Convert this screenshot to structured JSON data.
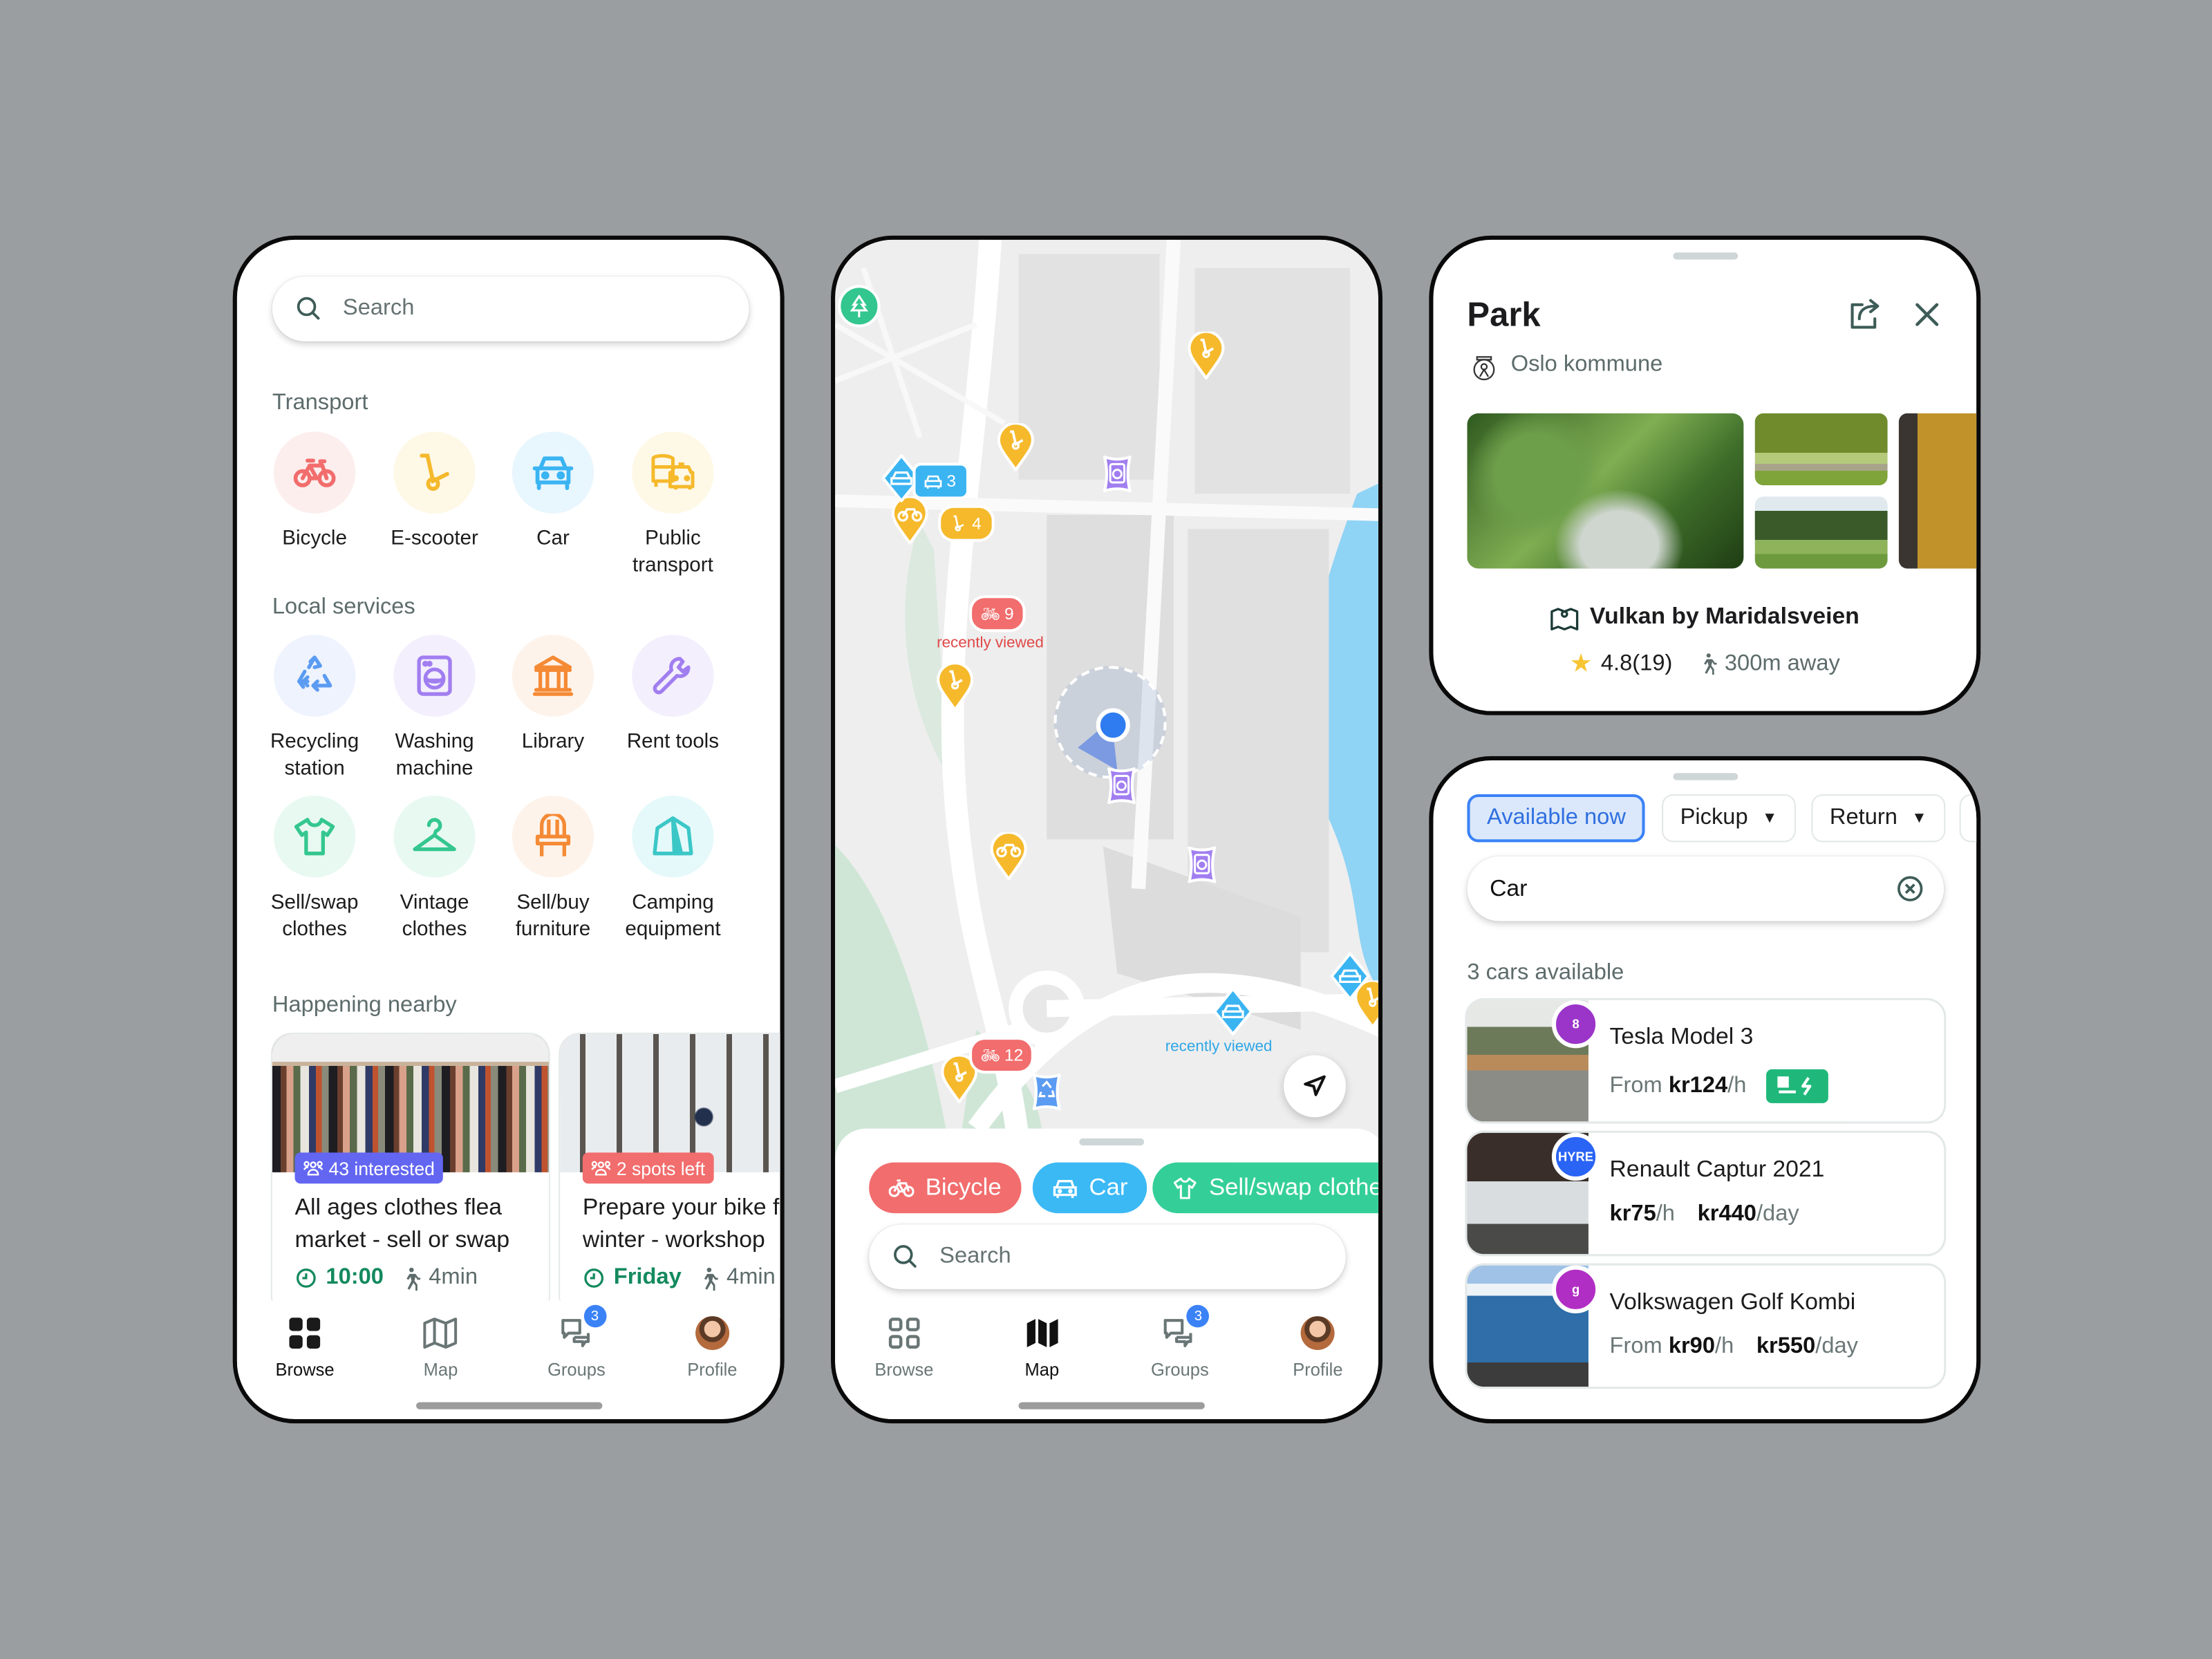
{
  "browse_screen": {
    "search_placeholder": "Search",
    "transport": {
      "title": "Transport",
      "items": [
        {
          "label": "Bicycle",
          "icon": "bicycle-icon",
          "color": "#f26d6d",
          "bg": "#fdeeee"
        },
        {
          "label": "E-scooter",
          "icon": "scooter-icon",
          "color": "#f5b92b",
          "bg": "#fef8e6"
        },
        {
          "label": "Car",
          "icon": "car-icon",
          "color": "#3bb4f2",
          "bg": "#e8f6fd"
        },
        {
          "label": "Public transport",
          "icon": "bus-taxi-icon",
          "color": "#f5b92b",
          "bg": "#fef8e6"
        }
      ]
    },
    "local_services": {
      "title": "Local services",
      "items": [
        {
          "label": "Recycling station",
          "icon": "recycle-icon",
          "color": "#5b9cf2",
          "bg": "#eef3fe"
        },
        {
          "label": "Washing machine",
          "icon": "washing-machine-icon",
          "color": "#a17ef0",
          "bg": "#f3effd"
        },
        {
          "label": "Library",
          "icon": "library-icon",
          "color": "#f58a35",
          "bg": "#fef3ea"
        },
        {
          "label": "Rent tools",
          "icon": "wrench-icon",
          "color": "#a17ef0",
          "bg": "#f3effd"
        },
        {
          "label": "Sell/swap clothes",
          "icon": "tshirt-icon",
          "color": "#34c78f",
          "bg": "#e8f9f2"
        },
        {
          "label": "Vintage clothes",
          "icon": "hanger-icon",
          "color": "#34c78f",
          "bg": "#e8f9f2"
        },
        {
          "label": "Sell/buy furniture",
          "icon": "chair-icon",
          "color": "#f58a35",
          "bg": "#fef3ea"
        },
        {
          "label": "Camping equipment",
          "icon": "tent-icon",
          "color": "#3cc7c7",
          "bg": "#e6f9fa"
        }
      ]
    },
    "happening_nearby": {
      "title": "Happening nearby",
      "events": [
        {
          "badge": "43 interested",
          "badge_color": "#6366f1",
          "title_line1": "All ages clothes flea",
          "title_line2": "market - sell or swap",
          "time": "10:00",
          "walk": "4min"
        },
        {
          "badge": "2 spots left",
          "badge_color": "#f26d6d",
          "title_line1": "Prepare your bike for",
          "title_line2": "winter - workshop",
          "time": "Friday",
          "walk": "4min"
        }
      ]
    }
  },
  "map_screen": {
    "markers": {
      "scooter_cluster": "4",
      "car_cluster": "3",
      "bike_cluster_top": "9",
      "bike_cluster_bottom": "12"
    },
    "recently_viewed_label": "recently viewed",
    "chips": [
      {
        "label": "Bicycle",
        "color": "#f26d6d"
      },
      {
        "label": "Car",
        "color": "#3bb9f5"
      },
      {
        "label": "Sell/swap clothes",
        "color": "#34cf98"
      }
    ],
    "search_placeholder": "Search"
  },
  "tabbar": {
    "items": [
      {
        "label": "Browse"
      },
      {
        "label": "Map"
      },
      {
        "label": "Groups",
        "badge": "3"
      },
      {
        "label": "Profile"
      }
    ]
  },
  "park_card": {
    "title": "Park",
    "owner": "Oslo kommune",
    "location": "Vulkan by Maridalsveien",
    "rating": "4.8(19)",
    "distance": "300m away"
  },
  "car_search": {
    "filters": [
      {
        "label": "Available now",
        "active": true
      },
      {
        "label": "Pickup",
        "dropdown": true
      },
      {
        "label": "Return",
        "dropdown": true
      }
    ],
    "search_value": "Car",
    "result_count": "3 cars available",
    "cars": [
      {
        "name": "Tesla Model 3",
        "provider_logo": "8",
        "logo_color": "#9b35c9",
        "prefix": "From",
        "price_hour": "kr124",
        "hour_unit": "/h",
        "price_day": "",
        "day_unit": "",
        "electric": true
      },
      {
        "name": "Renault Captur 2021",
        "provider_logo": "HYRE",
        "logo_color": "#2a64f5",
        "prefix": "",
        "price_hour": "kr75",
        "hour_unit": "/h",
        "price_day": "kr440",
        "day_unit": "/day",
        "electric": false
      },
      {
        "name": "Volkswagen Golf Kombi",
        "provider_logo": "g",
        "logo_color": "#b12ec4",
        "prefix": "From",
        "price_hour": "kr90",
        "hour_unit": "/h",
        "price_day": "kr550",
        "day_unit": "/day",
        "electric": false
      }
    ]
  }
}
